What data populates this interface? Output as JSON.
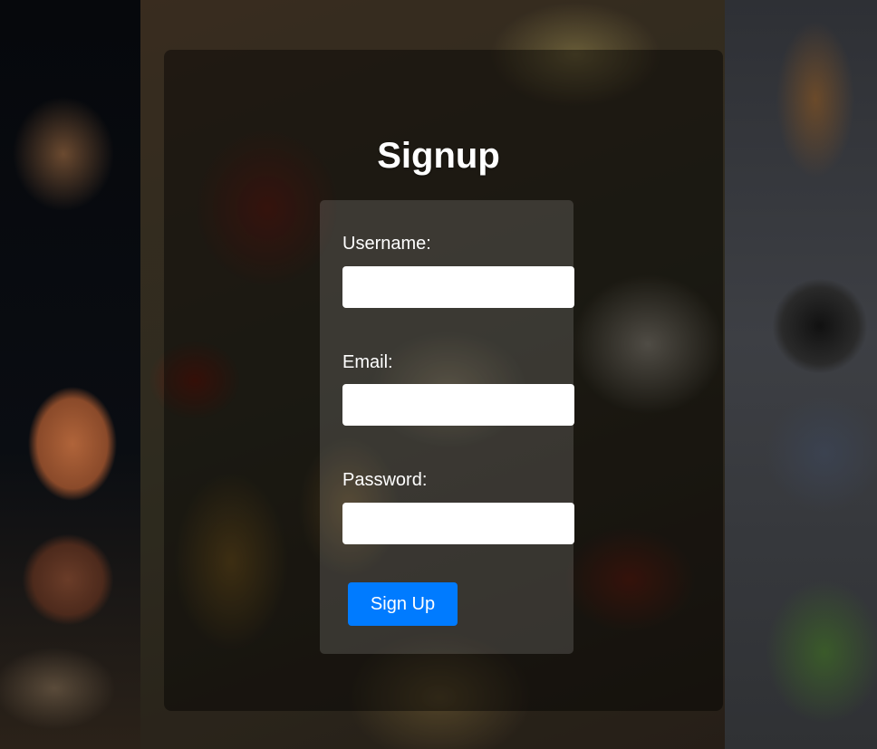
{
  "page": {
    "title": "Signup"
  },
  "form": {
    "username_label": "Username:",
    "username_value": "",
    "email_label": "Email:",
    "email_value": "",
    "password_label": "Password:",
    "password_value": "",
    "submit_label": "Sign Up"
  },
  "colors": {
    "button_bg": "#007bff",
    "button_text": "#ffffff",
    "title_text": "#ffffff"
  }
}
